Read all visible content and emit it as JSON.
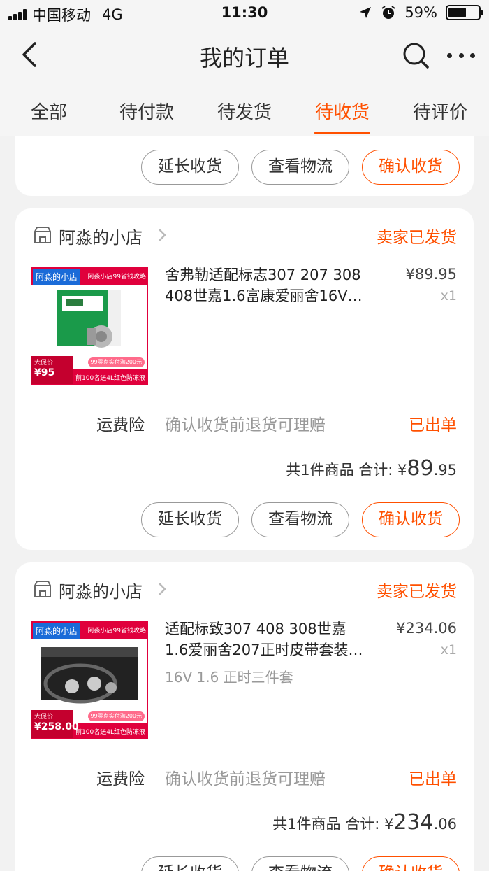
{
  "status_bar": {
    "carrier": "中国移动",
    "network": "4G",
    "time": "11:30",
    "battery_percent": "59%",
    "battery_level": 0.59
  },
  "nav": {
    "title": "我的订单"
  },
  "tabs": [
    {
      "label": "全部"
    },
    {
      "label": "待付款"
    },
    {
      "label": "待发货"
    },
    {
      "label": "待收货",
      "active": true
    },
    {
      "label": "待评价"
    }
  ],
  "order_actions": {
    "extend": "延长收货",
    "logistics": "查看物流",
    "confirm": "确认收货"
  },
  "orders": [
    {
      "shop": "阿淼的小店",
      "status": "卖家已发货",
      "thumb": {
        "shop_badge": "阿淼的小店",
        "promo": "阿淼小店99省钱攻略",
        "price_label": "大促价",
        "price": "¥95",
        "badge": "99零点实付满200元",
        "footer": "前100名送4L红色防冻液"
      },
      "title_line1": "舍弗勒适配标志307 207 308",
      "title_line2": "408世嘉1.6富康爱丽舍16V…",
      "price": "¥89.95",
      "qty": "x1",
      "spec": "",
      "insurance_label": "运费险",
      "insurance_desc": "确认收货前退货可理赔",
      "insurance_status": "已出单",
      "total_prefix": "共1件商品 合计: ¥",
      "total_int": "89",
      "total_dec": ".95"
    },
    {
      "shop": "阿淼的小店",
      "status": "卖家已发货",
      "thumb": {
        "shop_badge": "阿淼的小店",
        "promo": "阿淼小店99省钱攻略",
        "price_label": "大促价",
        "price": "¥258.00",
        "badge": "99零点实付满200元",
        "footer": "前100名送4L红色防冻液"
      },
      "title_line1": "适配标致307 408 308世嘉",
      "title_line2": "1.6爱丽舍207正时皮带套装…",
      "price": "¥234.06",
      "qty": "x1",
      "spec": "16V 1.6 正时三件套",
      "insurance_label": "运费险",
      "insurance_desc": "确认收货前退货可理赔",
      "insurance_status": "已出单",
      "total_prefix": "共1件商品 合计: ¥",
      "total_int": "234",
      "total_dec": ".06"
    }
  ],
  "colors": {
    "accent": "#ff5000",
    "badge_blue": "#1a6bd8",
    "thumb_red": "#e0003c"
  },
  "icons": {
    "back": "chevron-left-icon",
    "search": "search-icon",
    "more": "more-dots-icon",
    "shop": "shop-icon",
    "chevron": "chevron-right-icon"
  }
}
